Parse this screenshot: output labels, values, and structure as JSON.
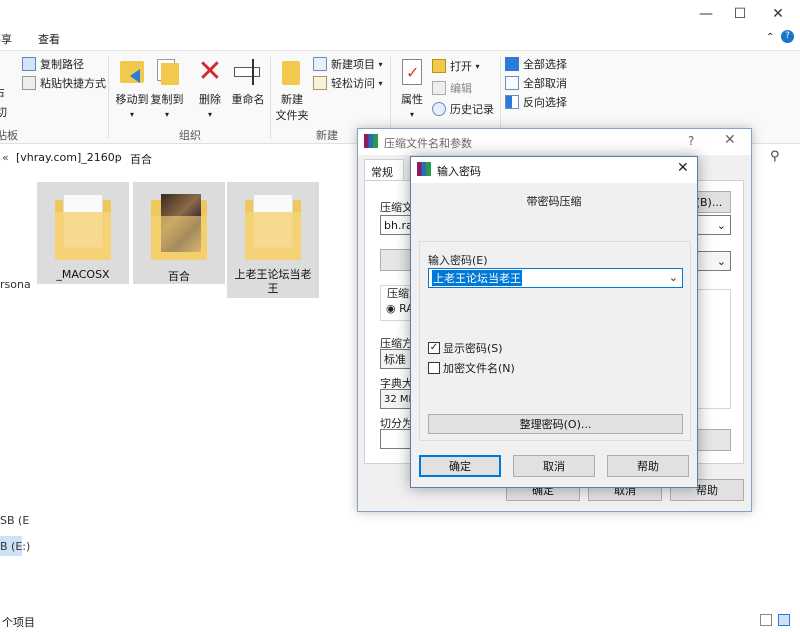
{
  "explorer": {
    "menu": {
      "share": "共享",
      "view": "查看"
    },
    "ribbon": {
      "clipboard": {
        "cut_fragment": "切",
        "paste_fragment": "占",
        "copy_path": "复制路径",
        "paste_shortcut": "粘贴快捷方式",
        "group_fragment": "贴板"
      },
      "organize": {
        "move_to": "移动到",
        "copy_to": "复制到",
        "delete": "删除",
        "rename": "重命名",
        "group": "组织"
      },
      "new": {
        "new_folder_line1": "新建",
        "new_folder_line2": "文件夹",
        "new_item": "新建项目",
        "easy_access": "轻松访问",
        "group": "新建"
      },
      "open": {
        "properties": "属性",
        "open": "打开",
        "edit": "编辑",
        "history": "历史记录"
      },
      "select": {
        "select_all": "全部选择",
        "select_none": "全部取消",
        "invert": "反向选择"
      }
    },
    "address": {
      "path_1": "[vhray.com]_2160p",
      "path_2": "百合"
    },
    "folders": [
      {
        "name": "_MACOSX"
      },
      {
        "name": "百合"
      },
      {
        "name": "上老王论坛当老王"
      }
    ],
    "sidebar": {
      "item_1": "rsona",
      "item_2": "SB (E",
      "item_3": "B (E:)"
    },
    "status": {
      "items": "个项目"
    }
  },
  "archive_dialog": {
    "title": "压缩文件名和参数",
    "help": "?",
    "tab_general": "常规",
    "archive_name_label": "压缩文",
    "archive_name_value": "bh.rar",
    "browse_button": "(B)...",
    "format_label": "压缩文",
    "format_option": "RA",
    "method_label": "压缩方",
    "method_value": "标准",
    "dict_label": "字典大",
    "dict_value": "32 MB",
    "split_label": "切分为",
    "ok": "确定",
    "cancel": "取消",
    "help_button": "帮助"
  },
  "password_dialog": {
    "title": "输入密码",
    "heading": "带密码压缩",
    "enter_password_label": "输入密码(E)",
    "password_value": "上老王论坛当老王",
    "show_password_label": "显示密码(S)",
    "show_password_checked": true,
    "encrypt_names_label": "加密文件名(N)",
    "encrypt_names_checked": false,
    "organize_button": "整理密码(O)...",
    "ok": "确定",
    "cancel": "取消",
    "help": "帮助"
  }
}
